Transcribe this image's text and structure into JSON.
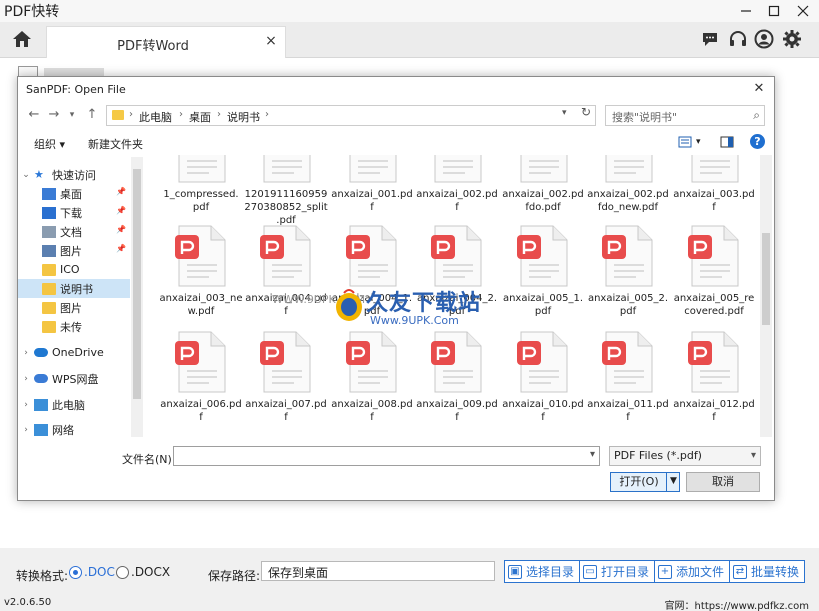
{
  "app": {
    "title": "PDF快转",
    "tab_label": "PDF转Word",
    "tab_close": "×",
    "version": "v2.0.6.50",
    "website": "官网：https://www.pdfkz.com"
  },
  "bottom": {
    "format_label": "转换格式:",
    "format_options": [
      ".DOC",
      ".DOCX"
    ],
    "format_selected": ".DOC",
    "path_label": "保存路径:",
    "path_value": "保存到桌面",
    "buttons": [
      "选择目录",
      "打开目录",
      "添加文件",
      "批量转换"
    ]
  },
  "dialog": {
    "title": "SanPDF: Open File",
    "close": "✕",
    "breadcrumbs": [
      "此电脑",
      "桌面",
      "说明书"
    ],
    "search_placeholder": "搜索\"说明书\"",
    "organize_label": "组织 ▾",
    "new_folder_label": "新建文件夹",
    "help": "?",
    "filename_label": "文件名(N):",
    "filename_value": "",
    "filter_value": "PDF Files (*.pdf)",
    "open_label": "打开(O)",
    "cancel_label": "取消"
  },
  "tree": [
    {
      "label": "快速访问",
      "icon": "star-icon",
      "expanded": true,
      "level": 0
    },
    {
      "label": "桌面",
      "icon": "desktop-icon",
      "pinned": true,
      "level": 1
    },
    {
      "label": "下载",
      "icon": "download-icon",
      "pinned": true,
      "level": 1
    },
    {
      "label": "文档",
      "icon": "documents-icon",
      "pinned": true,
      "level": 1
    },
    {
      "label": "图片",
      "icon": "pictures-icon",
      "pinned": true,
      "level": 1
    },
    {
      "label": "ICO",
      "icon": "folder-icon",
      "level": 1
    },
    {
      "label": "说明书",
      "icon": "folder-icon",
      "level": 1,
      "selected": true
    },
    {
      "label": "图片",
      "icon": "folder-icon",
      "level": 1
    },
    {
      "label": "未传",
      "icon": "folder-icon",
      "level": 1
    },
    {
      "label": "OneDrive",
      "icon": "cloud-icon",
      "level": 0
    },
    {
      "label": "WPS网盘",
      "icon": "wps-cloud-icon",
      "level": 0
    },
    {
      "label": "此电脑",
      "icon": "computer-icon",
      "level": 0
    },
    {
      "label": "网络",
      "icon": "network-icon",
      "level": 0
    }
  ],
  "files": [
    {
      "name": "1_compressed.pdf"
    },
    {
      "name": "1201911160959270380852_split.pdf"
    },
    {
      "name": "anxaizai_001.pdf"
    },
    {
      "name": "anxaizai_002.pdf"
    },
    {
      "name": "anxaizai_002.pdfdo.pdf"
    },
    {
      "name": "anxaizai_002.pdfdo_new.pdf"
    },
    {
      "name": "anxaizai_003.pdf"
    },
    {
      "name": "anxaizai_003_new.pdf"
    },
    {
      "name": "anxaizai_004.pdf"
    },
    {
      "name": "anxaizai_004_1.pdf"
    },
    {
      "name": "anxaizai_004_2.pdf"
    },
    {
      "name": "anxaizai_005_1.pdf"
    },
    {
      "name": "anxaizai_005_2.pdf"
    },
    {
      "name": "anxaizai_005_recovered.pdf"
    },
    {
      "name": "anxaizai_006.pdf"
    },
    {
      "name": "anxaizai_007.pdf"
    },
    {
      "name": "anxaizai_008.pdf"
    },
    {
      "name": "anxaizai_009.pdf"
    },
    {
      "name": "anxaizai_010.pdf"
    },
    {
      "name": "anxaizai_011.pdf"
    },
    {
      "name": "anxaizai_012.pdf"
    }
  ],
  "file_name_lines": [
    [
      "1_compressed.",
      "pdf"
    ],
    [
      "1201911160959",
      "270380852_split",
      ".pdf"
    ],
    [
      "anxaizai_001.pd",
      "f"
    ],
    [
      "anxaizai_002.pd",
      "f"
    ],
    [
      "anxaizai_002.pd",
      "fdo.pdf"
    ],
    [
      "anxaizai_002.pd",
      "fdo_new.pdf"
    ],
    [
      "anxaizai_003.pd",
      "f"
    ],
    [
      "anxaizai_003_ne",
      "w.pdf"
    ],
    [
      "anxaizai_004.pd",
      "f"
    ],
    [
      "anxaizai_004_1.",
      "pdf"
    ],
    [
      "anxaizai_004_2.",
      "pdf"
    ],
    [
      "anxaizai_005_1.",
      "pdf"
    ],
    [
      "anxaizai_005_2.",
      "pdf"
    ],
    [
      "anxaizai_005_re",
      "covered.pdf"
    ],
    [
      "anxaizai_006.pd",
      "f"
    ],
    [
      "anxaizai_007.pd",
      "f"
    ],
    [
      "anxaizai_008.pd",
      "f"
    ],
    [
      "anxaizai_009.pd",
      "f"
    ],
    [
      "anxaizai_010.pd",
      "f"
    ],
    [
      "anxaizai_011.pd",
      "f"
    ],
    [
      "anxaizai_012.pd",
      "f"
    ]
  ],
  "watermark": {
    "text": "久友下载站",
    "url": "Www.9UPK.Com",
    "url_small": "WWW.9UPK.COM"
  },
  "colors": {
    "accent": "#2b73cf",
    "pdf_red": "#e84c4c",
    "selection": "#cde4f7"
  }
}
